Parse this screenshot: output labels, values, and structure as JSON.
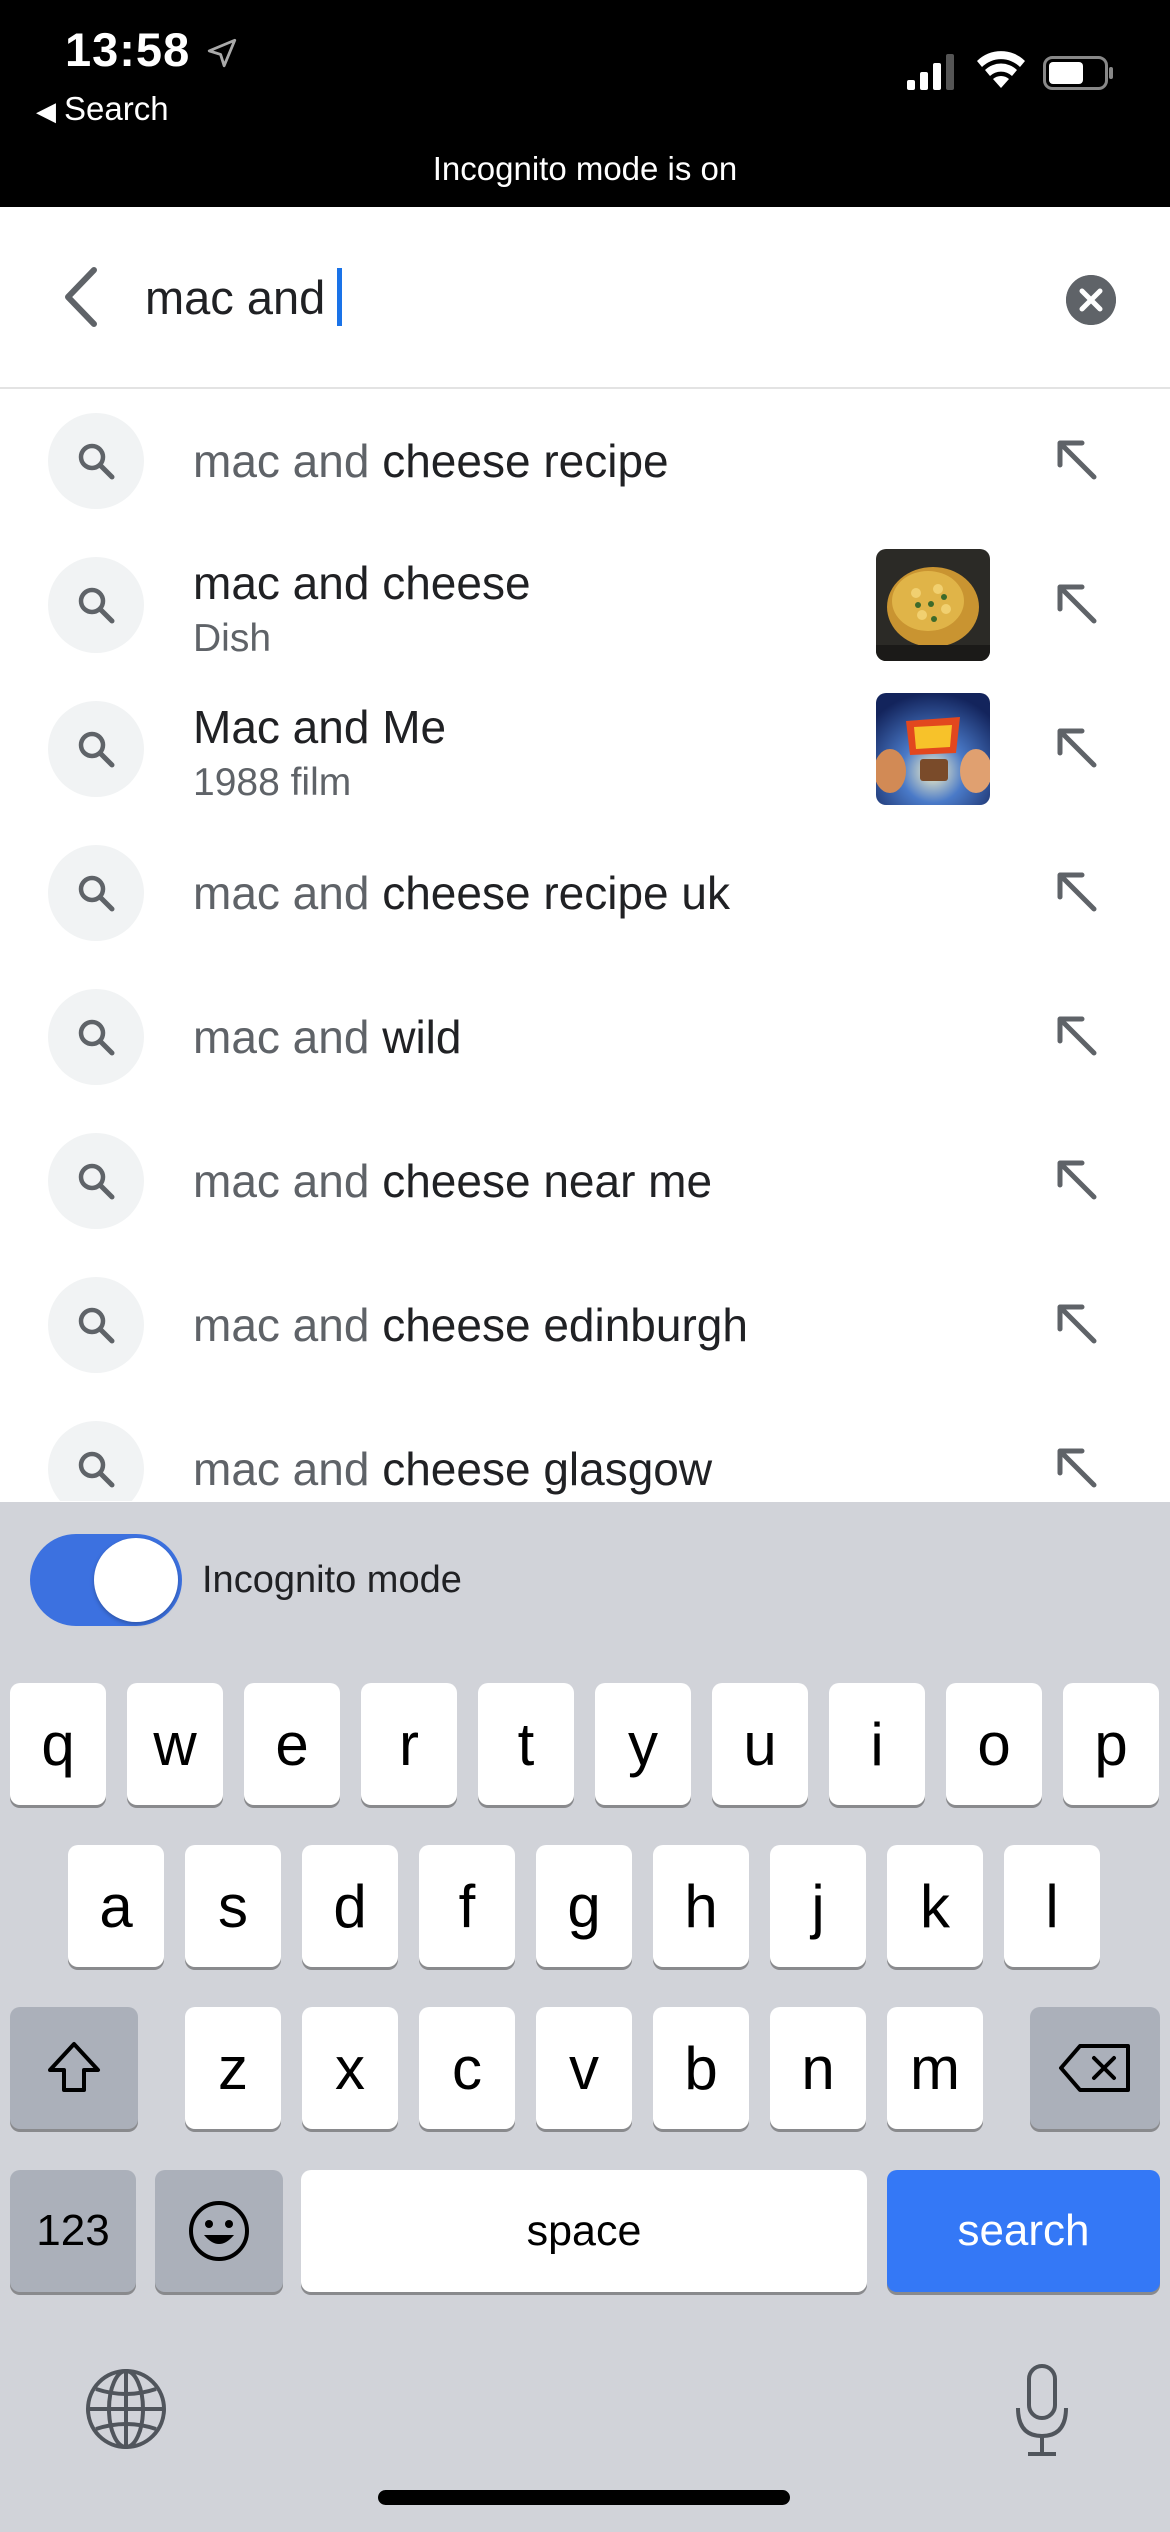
{
  "status_bar": {
    "time": "13:58",
    "back_label": "Search",
    "incognito_banner": "Incognito mode is on"
  },
  "search": {
    "query": "mac and",
    "back_icon": "chevron-left-icon",
    "clear_icon": "clear-circle-icon"
  },
  "suggestions": [
    {
      "prefix": "mac and",
      "completion": " cheese recipe"
    },
    {
      "title": "mac and cheese",
      "subtitle": "Dish",
      "thumbnail": "mac-and-cheese-photo"
    },
    {
      "title": "Mac and Me",
      "subtitle": "1988 film",
      "thumbnail": "mac-and-me-poster"
    },
    {
      "prefix": "mac and",
      "completion": " cheese recipe uk"
    },
    {
      "prefix": "mac and",
      "completion": " wild"
    },
    {
      "prefix": "mac and",
      "completion": " cheese near me"
    },
    {
      "prefix": "mac and",
      "completion": " cheese edinburgh"
    },
    {
      "prefix": "mac and",
      "completion": " cheese glasgow"
    }
  ],
  "keyboard": {
    "incognito_label": "Incognito mode",
    "incognito_on": true,
    "row1": [
      "q",
      "w",
      "e",
      "r",
      "t",
      "y",
      "u",
      "i",
      "o",
      "p"
    ],
    "row2": [
      "a",
      "s",
      "d",
      "f",
      "g",
      "h",
      "j",
      "k",
      "l"
    ],
    "row3": [
      "z",
      "x",
      "c",
      "v",
      "b",
      "n",
      "m"
    ],
    "numbers_label": "123",
    "space_label": "space",
    "search_label": "search"
  },
  "colors": {
    "accent_blue": "#3478f6",
    "toggle_blue": "#3c71e0",
    "caret_blue": "#1a73e8",
    "muted_text": "#5f6368"
  }
}
